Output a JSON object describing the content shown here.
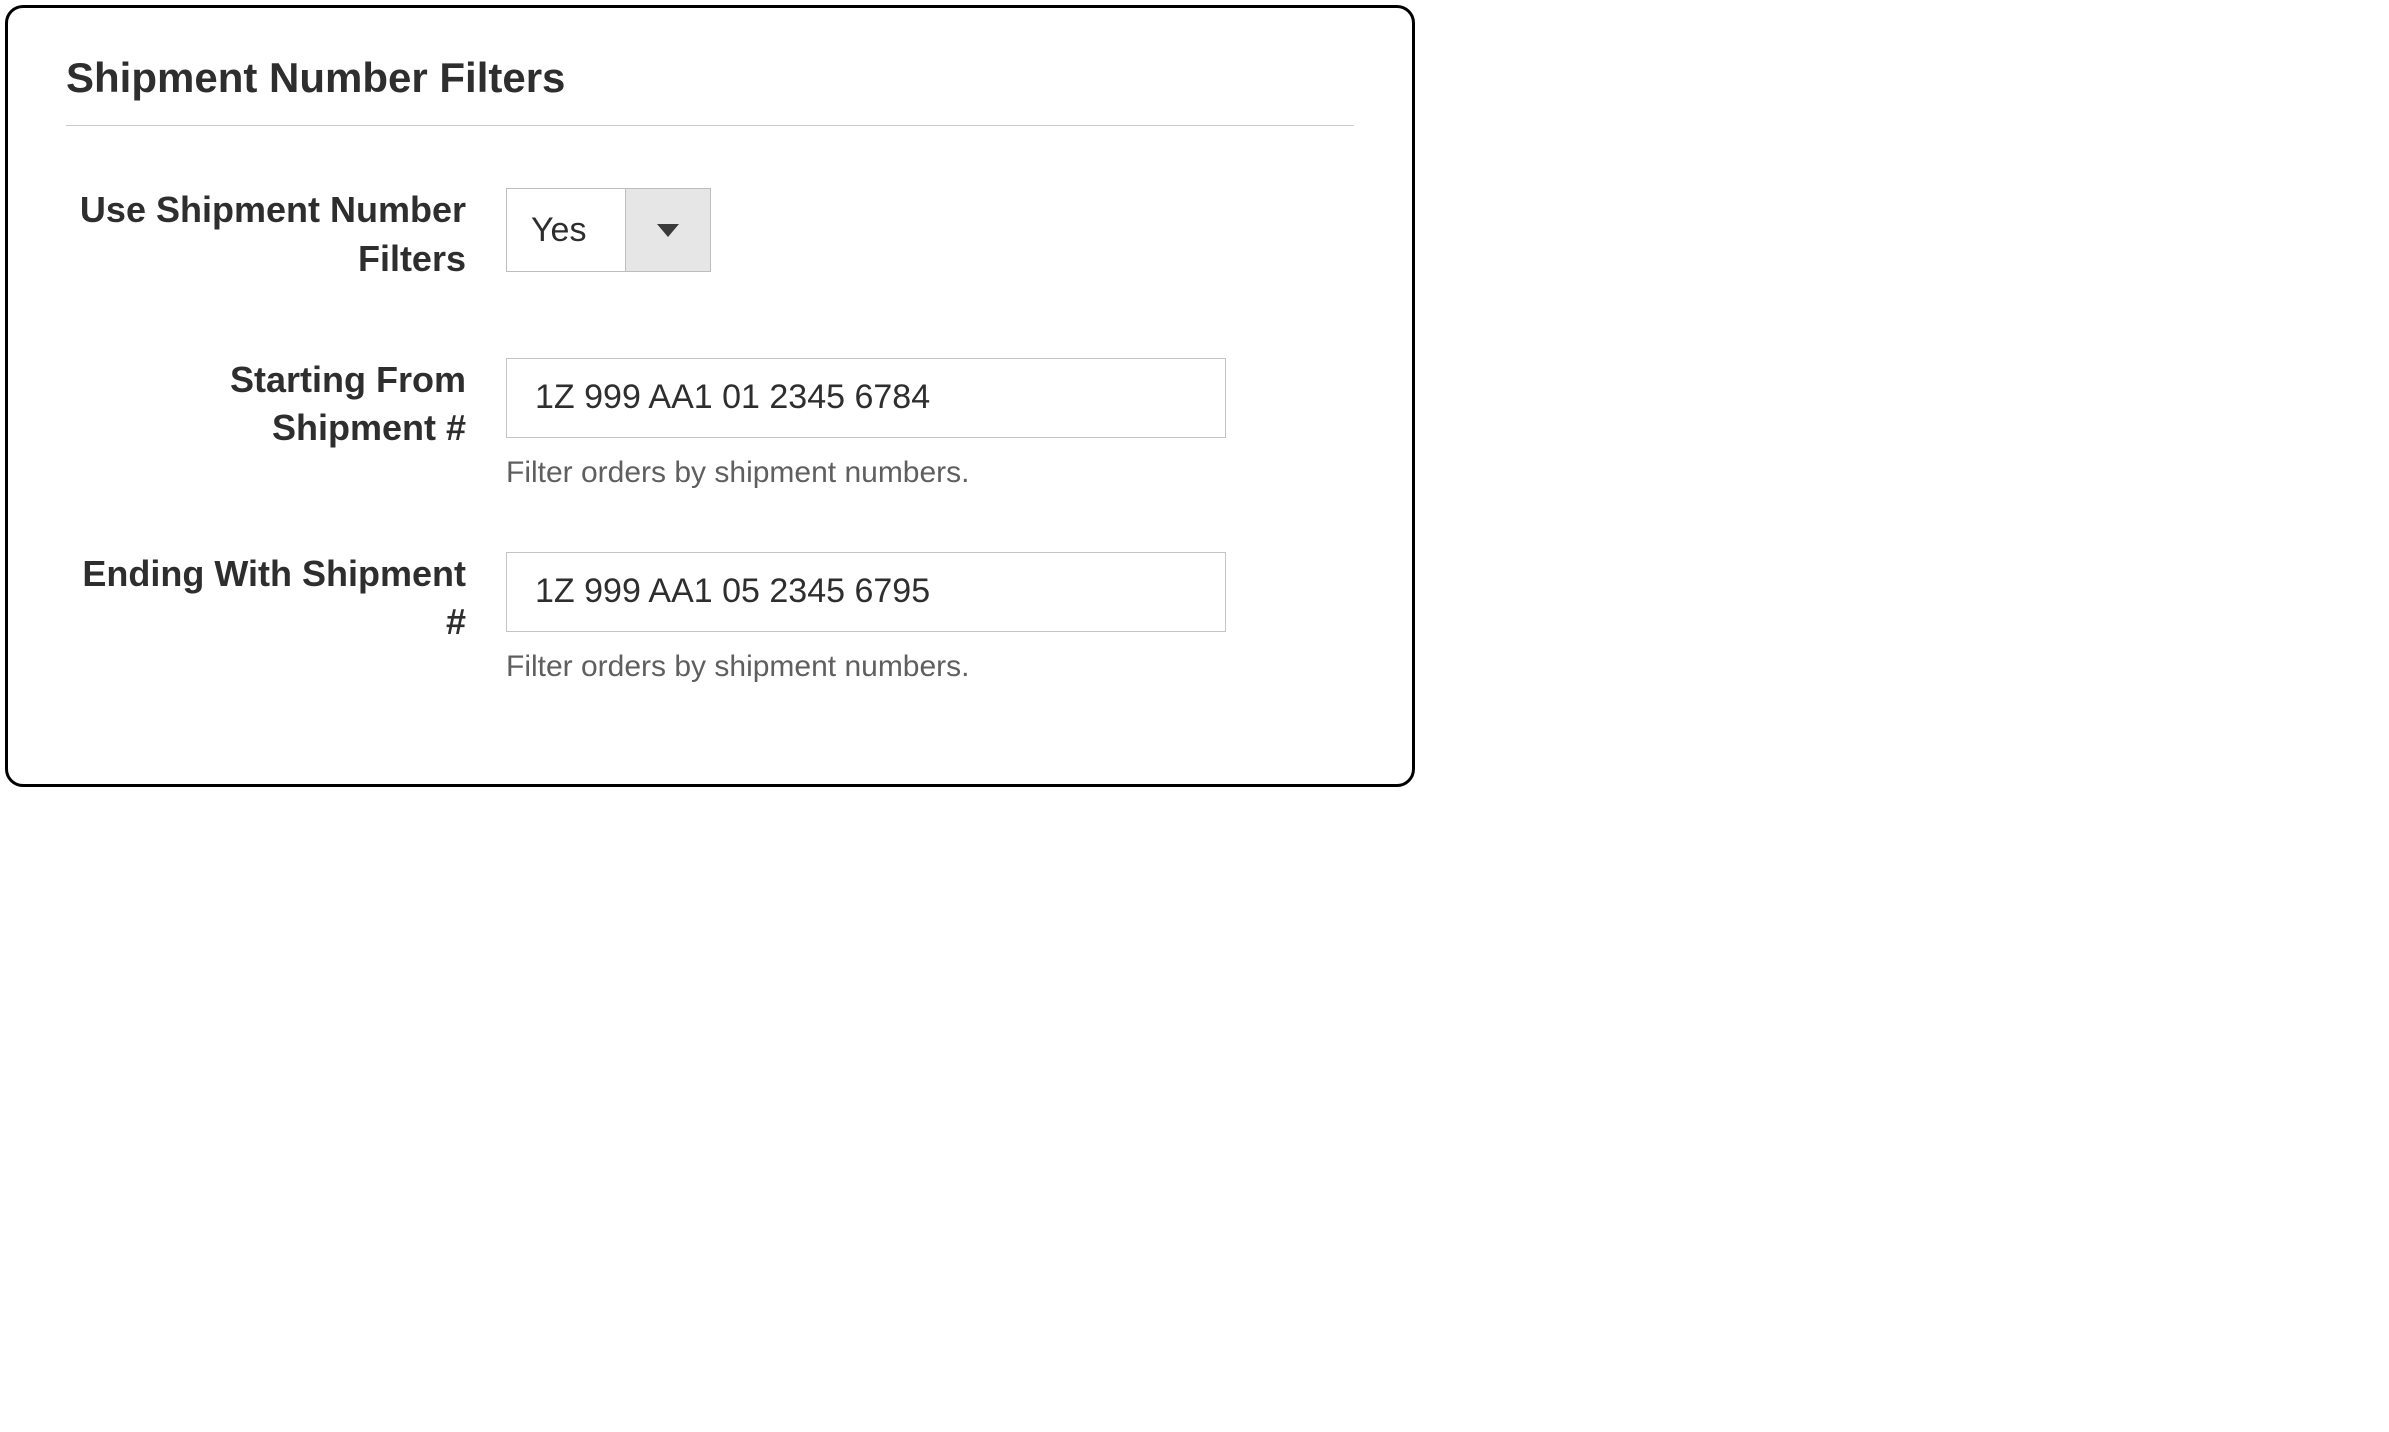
{
  "section": {
    "title": "Shipment Number Filters"
  },
  "fields": {
    "use_filters": {
      "label": "Use Shipment Number Filters",
      "value": "Yes"
    },
    "starting_from": {
      "label": "Starting From Shipment #",
      "value": "1Z 999 AA1 01 2345 6784",
      "note": "Filter orders by shipment numbers."
    },
    "ending_with": {
      "label": "Ending With Shipment #",
      "value": "1Z 999 AA1 05 2345 6795",
      "note": "Filter orders by shipment numbers."
    }
  }
}
